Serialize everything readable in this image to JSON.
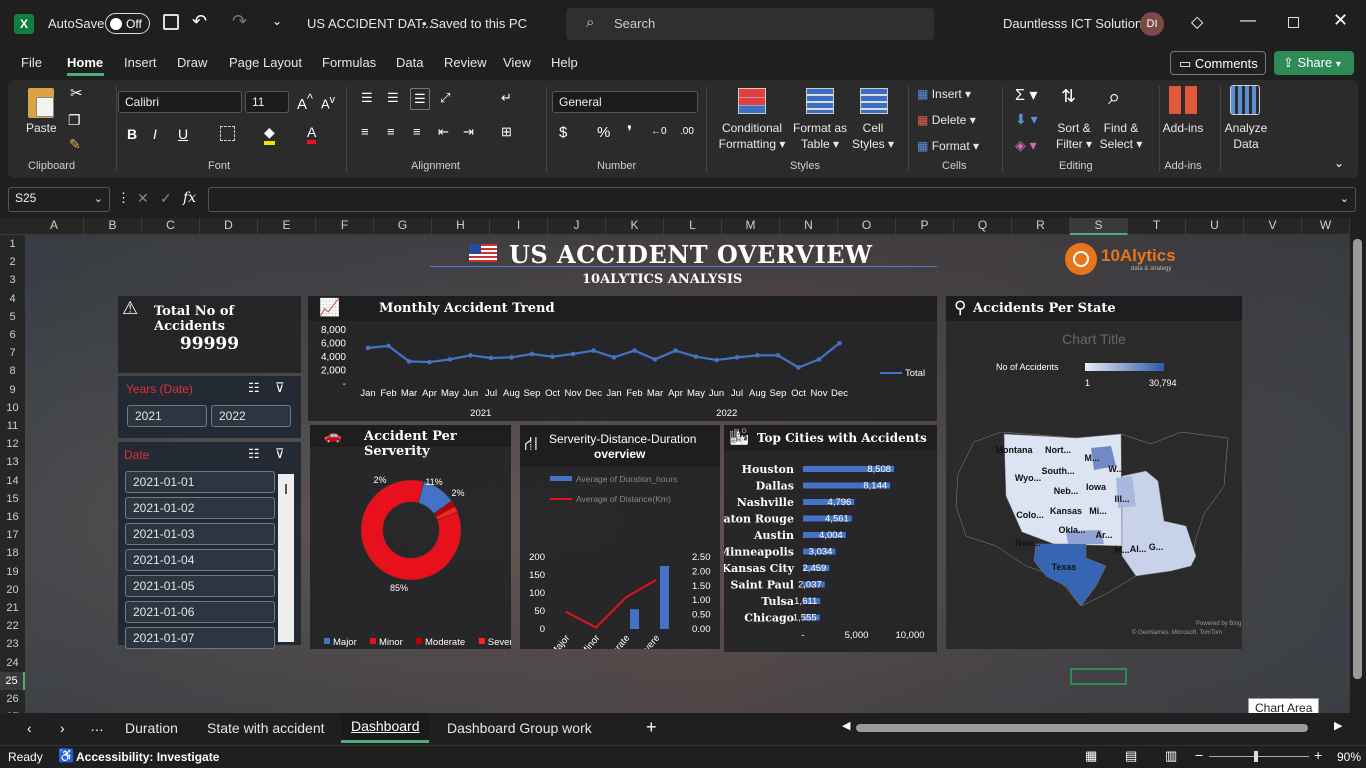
{
  "titlebar": {
    "autosave": "AutoSave",
    "toggle": "Off",
    "filename": "US ACCIDENT DAT...",
    "saved": "• Saved to this PC",
    "search_placeholder": "Search",
    "org": "Dauntlesss ICT Solutions",
    "avatar": "DI"
  },
  "ribbon_tabs": [
    "File",
    "Home",
    "Insert",
    "Draw",
    "Page Layout",
    "Formulas",
    "Data",
    "Review",
    "View",
    "Help"
  ],
  "ribbon_buttons": {
    "comments": "Comments",
    "share": "Share"
  },
  "clipboard": {
    "paste": "Paste",
    "group": "Clipboard"
  },
  "font": {
    "name": "Calibri",
    "size": "11",
    "group": "Font"
  },
  "alignment": {
    "group": "Alignment"
  },
  "number": {
    "format": "General",
    "group": "Number"
  },
  "styles": {
    "cond1": "Conditional",
    "cond2": "Formatting",
    "fmt1": "Format as",
    "fmt2": "Table",
    "cell1": "Cell",
    "cell2": "Styles",
    "group": "Styles"
  },
  "cells": {
    "insert": "Insert",
    "delete": "Delete",
    "format": "Format",
    "group": "Cells"
  },
  "editing": {
    "sort1": "Sort &",
    "sort2": "Filter",
    "find1": "Find &",
    "find2": "Select",
    "group": "Editing"
  },
  "addins": {
    "label": "Add-ins",
    "group": "Add-ins"
  },
  "analyze": {
    "l1": "Analyze",
    "l2": "Data"
  },
  "formula_bar": {
    "namebox": "S25",
    "fx": "fx",
    "formula": ""
  },
  "columns": [
    "A",
    "B",
    "C",
    "D",
    "E",
    "F",
    "G",
    "H",
    "I",
    "J",
    "K",
    "L",
    "M",
    "N",
    "O",
    "P",
    "Q",
    "R",
    "S",
    "T",
    "U",
    "V",
    "W"
  ],
  "rows": [
    "1",
    "2",
    "3",
    "4",
    "5",
    "6",
    "7",
    "8",
    "9",
    "10",
    "11",
    "12",
    "13",
    "14",
    "15",
    "16",
    "17",
    "18",
    "19",
    "20",
    "21",
    "22",
    "23",
    "24",
    "25",
    "26",
    "27"
  ],
  "dashboard": {
    "title": "US ACCIDENT OVERVIEW",
    "subtitle": "10ALYTICS ANALYSIS",
    "logo": "10Alytics",
    "logo_sub": "data & strategy",
    "total_label": "Total No of Accidents",
    "total_value": "99999",
    "years_label": "Years (Date)",
    "years": [
      "2021",
      "2022"
    ],
    "date_label": "Date",
    "dates": [
      "2021-01-01",
      "2021-01-02",
      "2021-01-03",
      "2021-01-04",
      "2021-01-05",
      "2021-01-06",
      "2021-01-07"
    ],
    "monthly_title": "Monthly Accident Trend",
    "severity_title": "Accident Per Serverity",
    "sdd_title1": "Serverity-Distance-Duration",
    "sdd_title2": "overview",
    "cities_title": "Top Cities with Accidents",
    "state_title": "Accidents Per State",
    "map_chart_title": "Chart Title",
    "map_legend_label": "No of Accidents",
    "map_min": "1",
    "map_max": "30,794",
    "map_states": [
      "Montana",
      "Nort...",
      "M...",
      "Wyo...",
      "South...",
      "W...",
      "Neb...",
      "Iowa",
      "Ill...",
      "Colo...",
      "Kansas",
      "Mi...",
      "New...",
      "Okla...",
      "Ar...",
      "Texas",
      "M...",
      "Al...",
      "G..."
    ],
    "map_credit1": "Powered by Bing",
    "map_credit2": "© GeoNames, Microsoft, TomTom"
  },
  "chart_data": [
    {
      "type": "line",
      "title": "Monthly Accident Trend",
      "series": [
        {
          "name": "Total",
          "values": [
            5200,
            5500,
            3200,
            3100,
            3500,
            4100,
            3700,
            3800,
            4300,
            3900,
            4300,
            4800,
            3800,
            4800,
            3500,
            4800,
            3900,
            3400,
            3800,
            4100,
            4100,
            2300,
            3500,
            5900
          ]
        }
      ],
      "x": [
        "Jan",
        "Feb",
        "Mar",
        "Apr",
        "May",
        "Jun",
        "Jul",
        "Aug",
        "Sep",
        "Oct",
        "Nov",
        "Dec",
        "Jan",
        "Feb",
        "Mar",
        "Apr",
        "May",
        "Jun",
        "Jul",
        "Aug",
        "Sep",
        "Oct",
        "Nov",
        "Dec"
      ],
      "year_labels": [
        "2021",
        "2022"
      ],
      "ytick_labels": [
        "8,000",
        "6,000",
        "4,000",
        "2,000",
        "-"
      ],
      "ylim": [
        0,
        8000
      ]
    },
    {
      "type": "pie",
      "title": "Accident Per Serverity",
      "categories": [
        "Major",
        "Minor",
        "Moderate",
        "Severe"
      ],
      "values": [
        11,
        85,
        2,
        2
      ],
      "data_labels": [
        "11%",
        "85%",
        "2%",
        "2%"
      ],
      "colors": [
        "#4472c4",
        "#e8101a",
        "#c00000",
        "#ff2020"
      ]
    },
    {
      "type": "bar",
      "title": "Serverity-Distance-Duration overview",
      "categories": [
        "Major",
        "Minor",
        "Moderate",
        "Severe"
      ],
      "series": [
        {
          "name": "Average of Duration_hours",
          "values": [
            0,
            0,
            55,
            175
          ]
        },
        {
          "name": "Average of Distance(Km)",
          "values": [
            0.6,
            0.05,
            1.1,
            1.7
          ]
        }
      ],
      "y_ticks": [
        "200",
        "150",
        "100",
        "50",
        "0"
      ],
      "y2_ticks": [
        "2.50",
        "2.00",
        "1.50",
        "1.00",
        "0.50",
        "0.00"
      ],
      "ylim": [
        0,
        200
      ],
      "y2lim": [
        0,
        2.5
      ]
    },
    {
      "type": "bar",
      "title": "Top Cities with Accidents",
      "categories": [
        "Houston",
        "Dallas",
        "Nashville",
        "Baton Rouge",
        "Austin",
        "Minneapolis",
        "Kansas City",
        "Saint Paul",
        "Tulsa",
        "Chicago"
      ],
      "values": [
        8508,
        8144,
        4796,
        4561,
        4004,
        3034,
        2459,
        2037,
        1611,
        1555
      ],
      "data_labels": [
        "8,508",
        "8,144",
        "4,796",
        "4,561",
        "4,004",
        "3,034",
        "2,459",
        "2,037",
        "1,611",
        "1,555"
      ],
      "x_ticks": [
        "-",
        "5,000",
        "10,000"
      ],
      "xlim": [
        0,
        10000
      ]
    }
  ],
  "sheet_tabs": [
    "Duration",
    "State with accident",
    "Dashboard",
    "Dashboard Group work"
  ],
  "tooltip": "Chart Area",
  "status": {
    "ready": "Ready",
    "accessibility": "Accessibility: Investigate",
    "zoom": "90%"
  }
}
